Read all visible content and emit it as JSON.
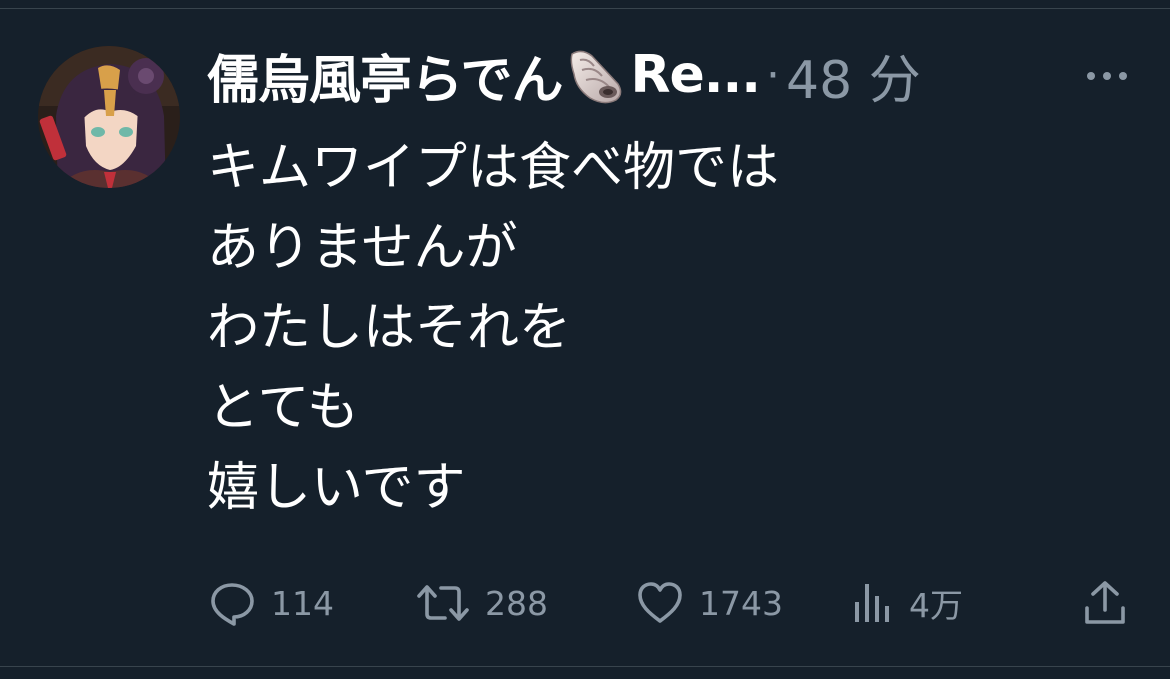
{
  "tweet": {
    "author": {
      "display_name": "儒烏風亭らでん",
      "name_emoji": "spiral-shell-icon",
      "name_suffix": "Re...",
      "separator": "·",
      "timestamp": "48 分"
    },
    "body_lines": [
      "キムワイプは食べ物では",
      "ありませんが",
      "わたしはそれを",
      "とても",
      "嬉しいです"
    ],
    "actions": {
      "reply": {
        "icon": "reply-icon",
        "count": "114"
      },
      "retweet": {
        "icon": "retweet-icon",
        "count": "288"
      },
      "like": {
        "icon": "heart-icon",
        "count": "1743"
      },
      "views": {
        "icon": "views-icon",
        "count": "4万"
      },
      "share": {
        "icon": "share-icon"
      }
    },
    "more_icon": "more-icon"
  },
  "colors": {
    "background": "#15202b",
    "text": "#ffffff",
    "secondary": "#8b98a5",
    "divider": "#38444d"
  }
}
